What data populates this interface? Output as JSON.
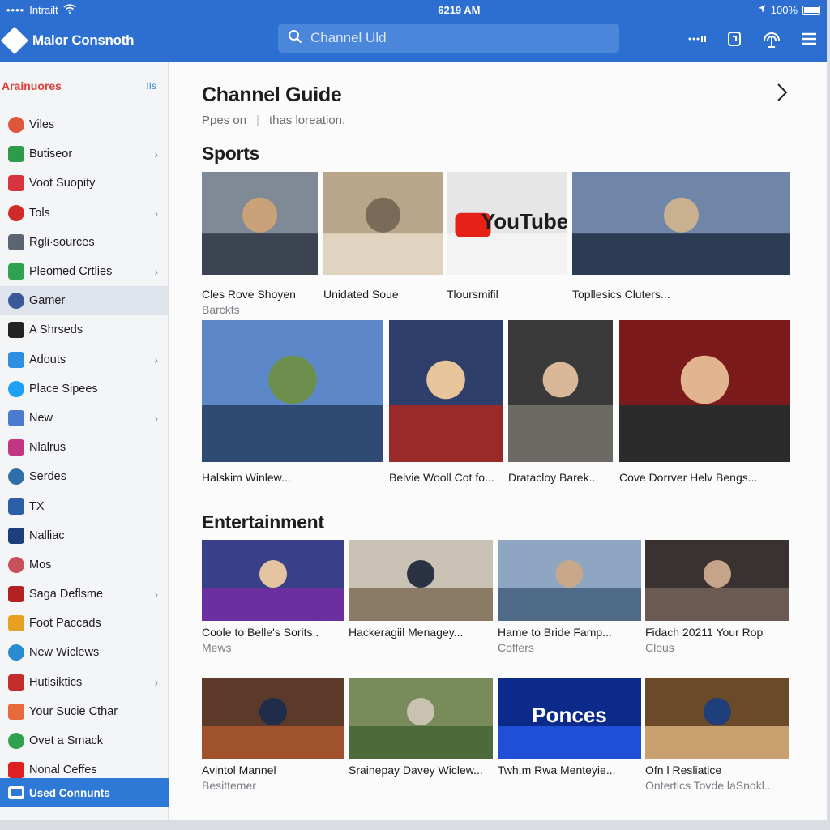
{
  "status": {
    "carrier": "Intrailt",
    "time": "6219 AM",
    "battery": "100%"
  },
  "app": {
    "name": "Malor Consnoth"
  },
  "search": {
    "placeholder": "Channel Uld"
  },
  "sidebar": {
    "heading": "Arainuores",
    "heading_action": "IIs",
    "items": [
      {
        "label": "Viles",
        "icon": "app-icon",
        "color": "#e0563a"
      },
      {
        "label": "Butiseor",
        "icon": "app-icon",
        "color": "#2e9b4b",
        "chevron": true
      },
      {
        "label": "Voot Suopity",
        "icon": "app-icon",
        "color": "#d8343f"
      },
      {
        "label": "Tols",
        "icon": "app-icon",
        "color": "#d02a2a",
        "chevron": true
      },
      {
        "label": "Rgli·sources",
        "icon": "app-icon",
        "color": "#5b6470"
      },
      {
        "label": "Pleomed Crtlies",
        "icon": "app-icon",
        "color": "#2fa24f",
        "chevron": true
      },
      {
        "label": "Gamer",
        "icon": "facebook-icon",
        "color": "#3b5998",
        "active": true
      },
      {
        "label": "A Shrseds",
        "icon": "app-icon",
        "color": "#222222"
      },
      {
        "label": "Adouts",
        "icon": "app-icon",
        "color": "#2c8fe0",
        "chevron": true
      },
      {
        "label": "Place Sipees",
        "icon": "twitter-icon",
        "color": "#1da1f2"
      },
      {
        "label": "New",
        "icon": "app-icon",
        "color": "#4b7bd0",
        "chevron": true
      },
      {
        "label": "Nlalrus",
        "icon": "instagram-icon",
        "color": "#c13584"
      },
      {
        "label": "Serdes",
        "icon": "app-icon",
        "color": "#2f6ea8"
      },
      {
        "label": "TX",
        "icon": "app-icon",
        "color": "#2c5fa8"
      },
      {
        "label": "Nalliac",
        "icon": "app-icon",
        "color": "#1c3e7a"
      },
      {
        "label": "Mos",
        "icon": "app-icon",
        "color": "#c8505b"
      },
      {
        "label": "Saga Deflsme",
        "icon": "app-icon",
        "color": "#b22222",
        "chevron": true
      },
      {
        "label": "Foot Paccads",
        "icon": "app-icon",
        "color": "#e8a020"
      },
      {
        "label": "New Wiclews",
        "icon": "app-icon",
        "color": "#2a8bd0"
      },
      {
        "label": "Hutisiktics",
        "icon": "app-icon",
        "color": "#c42b2b",
        "chevron": true
      },
      {
        "label": "Your Sucie Cthar",
        "icon": "app-icon",
        "color": "#e86a3a"
      },
      {
        "label": "Ovet a Smack",
        "icon": "app-icon",
        "color": "#2fa24f"
      },
      {
        "label": "Nonal Ceffes",
        "icon": "youtube-icon",
        "color": "#e02020"
      }
    ],
    "footer": "Used Connunts"
  },
  "main": {
    "title": "Channel Guide",
    "subtitle_left": "Ppes on",
    "subtitle_right": "thas loreation.",
    "sections": [
      {
        "title": "Sports",
        "rows": [
          [
            {
              "title": "Cles Rove Shoyen",
              "sub": "Barckts"
            },
            {
              "title": "Unidated Soue",
              "sub": ""
            },
            {
              "title": "Tloursmifil",
              "sub": "",
              "logo": "YouTube"
            },
            {
              "title": "Topllesics Cluters...",
              "sub": ""
            }
          ],
          [
            {
              "title": "Halskim Winlew...",
              "sub": ""
            },
            {
              "title": "Belvie Wooll Cot fo...",
              "sub": ""
            },
            {
              "title": "Dratacloy Barek..",
              "sub": ""
            },
            {
              "title": "Cove Dorrver Helv Bengs...",
              "sub": ""
            }
          ]
        ]
      },
      {
        "title": "Entertainment",
        "rows": [
          [
            {
              "title": "Coole to Belle's Sorits..",
              "sub": "Mews"
            },
            {
              "title": "Hackeragiil Menagey...",
              "sub": ""
            },
            {
              "title": "Hame to Bride Famp...",
              "sub": "Coffers"
            },
            {
              "title": "Fidach 20211 Your Rop",
              "sub": "Clous"
            }
          ],
          [
            {
              "title": "Avintol Mannel",
              "sub": "Besittemer"
            },
            {
              "title": "Srainepay Davey Wiclew...",
              "sub": ""
            },
            {
              "title": "Twh.m Rwa Menteyie...",
              "sub": "",
              "logo": "Ponces"
            },
            {
              "title": "Ofn l Resliatice",
              "sub": "Ontertics Tovde laSnokl..."
            }
          ]
        ]
      }
    ]
  }
}
